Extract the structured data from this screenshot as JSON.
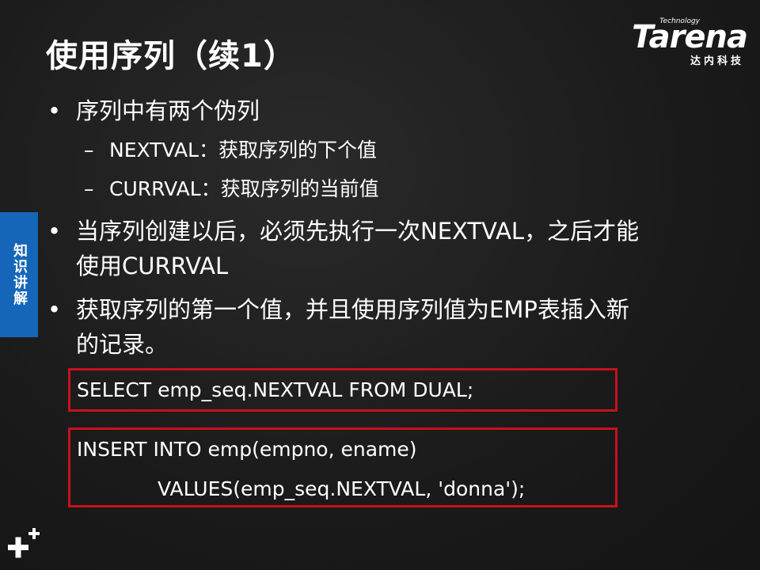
{
  "title": "使用序列（续1）",
  "logo": {
    "tagline": "Technology",
    "brand": "Tarena",
    "chinese": "达内科技"
  },
  "side_tab": "知识讲解",
  "bullet_symbol": "•",
  "dash_symbol": "–",
  "bullets": {
    "b1": "序列中有两个伪列",
    "b1_sub1": "NEXTVAL：获取序列的下个值",
    "b1_sub2": "CURRVAL：获取序列的当前值",
    "b2_line1": "当序列创建以后，必须先执行一次NEXTVAL，之后才能",
    "b2_line2": "使用CURRVAL",
    "b3_line1": "获取序列的第一个值，并且使用序列值为EMP表插入新",
    "b3_line2": "的记录。"
  },
  "code": {
    "block1_line1": "SELECT emp_seq.NEXTVAL FROM DUAL;",
    "block2_line1": "INSERT INTO emp(empno, ename)",
    "block2_line2": "VALUES(emp_seq.NEXTVAL, 'donna');"
  },
  "colors": {
    "side_tab": "#1566b8",
    "code_border": "#c8101e"
  },
  "icons": {
    "bottom_left": "plus-plus-icon"
  }
}
